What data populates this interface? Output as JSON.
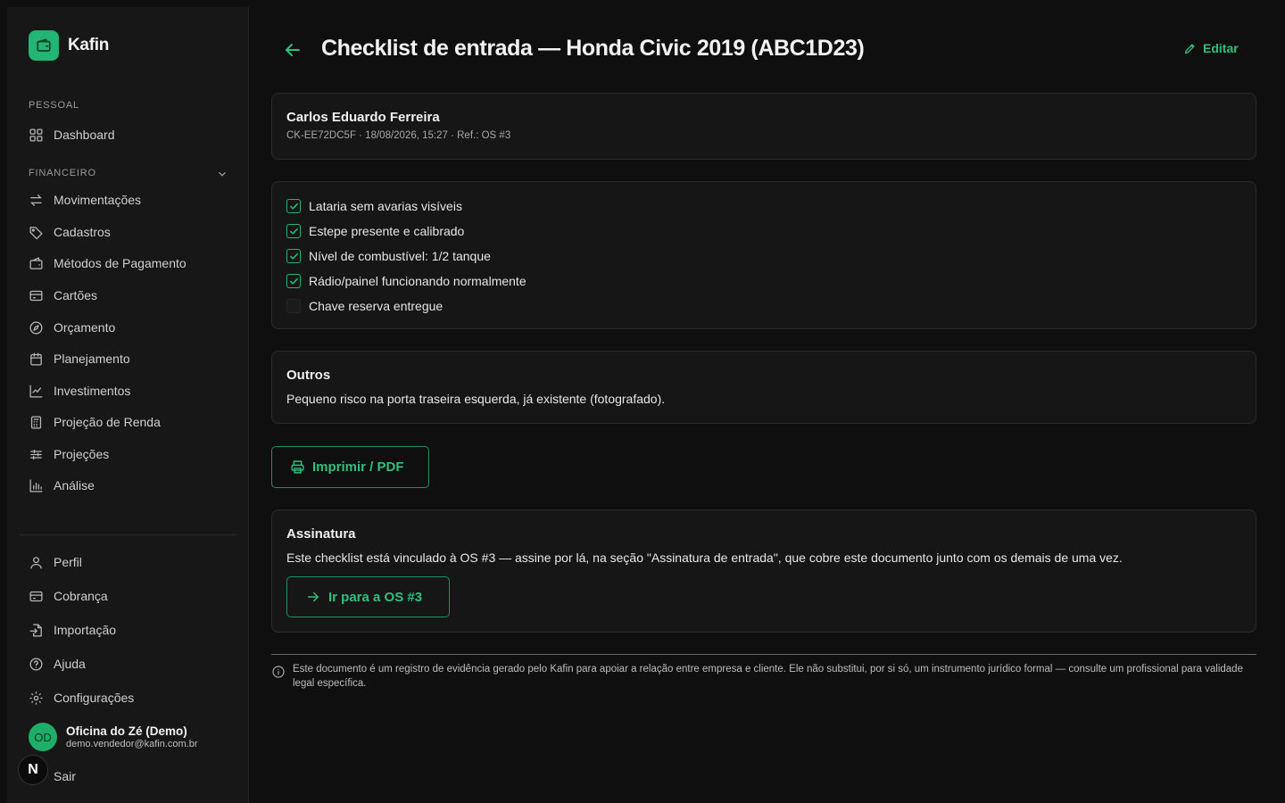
{
  "app": {
    "name": "Kafin"
  },
  "sidebar": {
    "section_personal": "PESSOAL",
    "section_financial": "FINANCEIRO",
    "personal_items": [
      {
        "label": "Dashboard",
        "icon": "grid-icon"
      }
    ],
    "financial_items": [
      {
        "label": "Movimentações",
        "icon": "arrows-icon"
      },
      {
        "label": "Cadastros",
        "icon": "tag-icon"
      },
      {
        "label": "Métodos de Pagamento",
        "icon": "wallet-icon"
      },
      {
        "label": "Cartões",
        "icon": "card-icon"
      },
      {
        "label": "Orçamento",
        "icon": "compass-icon"
      },
      {
        "label": "Planejamento",
        "icon": "calendar-icon"
      },
      {
        "label": "Investimentos",
        "icon": "chart-line-icon"
      },
      {
        "label": "Projeção de Renda",
        "icon": "calculator-icon"
      },
      {
        "label": "Projeções",
        "icon": "sliders-icon"
      },
      {
        "label": "Análise",
        "icon": "bar-chart-icon"
      }
    ],
    "bottom_items": [
      {
        "label": "Perfil",
        "icon": "user-icon"
      },
      {
        "label": "Cobrança",
        "icon": "card-icon"
      },
      {
        "label": "Importação",
        "icon": "file-import-icon"
      },
      {
        "label": "Ajuda",
        "icon": "help-icon"
      },
      {
        "label": "Configurações",
        "icon": "gear-icon"
      }
    ],
    "user": {
      "initials": "OD",
      "name": "Oficina do Zé (Demo)",
      "email": "demo.vendedor@kafin.com.br"
    },
    "logout": "Sair",
    "badge": "N"
  },
  "header": {
    "title": "Checklist de entrada — Honda Civic 2019 (ABC1D23)",
    "edit_label": "Editar"
  },
  "customer": {
    "name": "Carlos Eduardo Ferreira",
    "meta": "CK-EE72DC5F · 18/08/2026, 15:27 · Ref.: OS #3"
  },
  "checklist": [
    {
      "label": "Lataria sem avarias visíveis",
      "checked": true
    },
    {
      "label": "Estepe presente e calibrado",
      "checked": true
    },
    {
      "label": "Nível de combustível: 1/2 tanque",
      "checked": true
    },
    {
      "label": "Rádio/painel funcionando normalmente",
      "checked": true
    },
    {
      "label": "Chave reserva entregue",
      "checked": false
    }
  ],
  "others": {
    "title": "Outros",
    "text": "Pequeno risco na porta traseira esquerda, já existente (fotografado)."
  },
  "print_label": "Imprimir / PDF",
  "signature": {
    "title": "Assinatura",
    "text": "Este checklist está vinculado à OS #3 — assine por lá, na seção \"Assinatura de entrada\", que cobre este documento junto com os demais de uma vez.",
    "button_label": "Ir para a OS #3"
  },
  "disclaimer": "Este documento é um registro de evidência gerado pelo Kafin para apoiar a relação entre empresa e cliente. Ele não substitui, por si só, um instrumento jurídico formal — consulte um profissional para validade legal específica.",
  "colors": {
    "accent": "#22b573",
    "background": "#0f0f0f",
    "card": "#161616"
  }
}
